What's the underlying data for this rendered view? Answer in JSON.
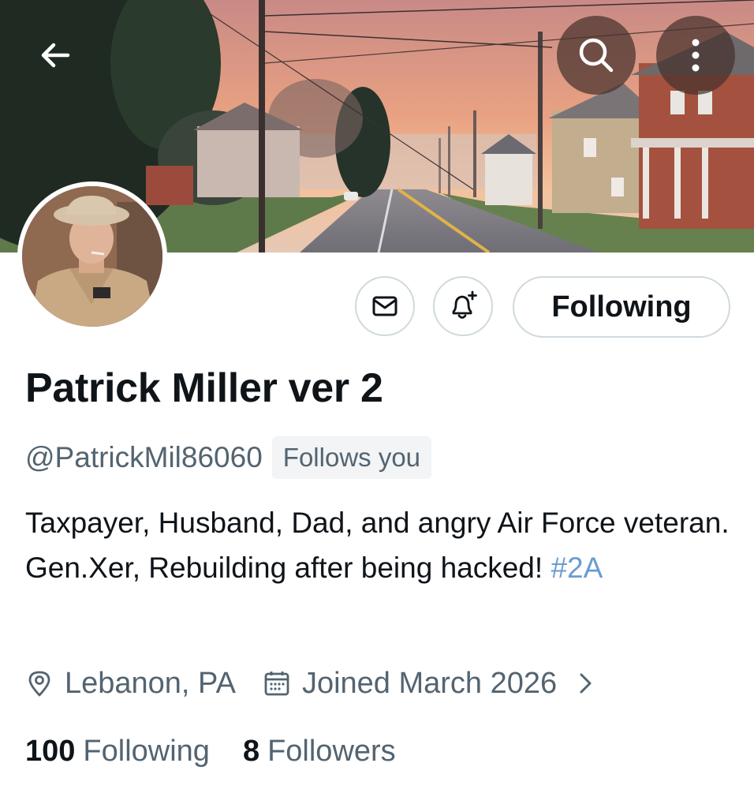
{
  "header": {
    "back_icon": "arrow-left-icon",
    "search_icon": "search-icon",
    "more_icon": "more-vertical-icon"
  },
  "actions": {
    "message_icon": "envelope-icon",
    "notify_icon": "bell-plus-icon",
    "following_label": "Following"
  },
  "profile": {
    "display_name": "Patrick Miller ver 2",
    "handle": "@PatrickMil86060",
    "follows_you_badge": "Follows you",
    "bio_text": "Taxpayer, Husband, Dad, and angry Air Force veteran. Gen.Xer, Rebuilding after being hacked! ",
    "bio_hashtag": "#2A",
    "location": "Lebanon, PA",
    "joined": "Joined March 2026",
    "location_icon": "location-pin-icon",
    "joined_icon": "calendar-icon",
    "expand_icon": "chevron-right-icon"
  },
  "stats": {
    "following_count": "100",
    "following_label": "Following",
    "followers_count": "8",
    "followers_label": "Followers"
  },
  "colors": {
    "text_primary": "#0f1419",
    "text_secondary": "#536471",
    "hashtag": "#6a9bd1",
    "border": "#cfd9de"
  }
}
